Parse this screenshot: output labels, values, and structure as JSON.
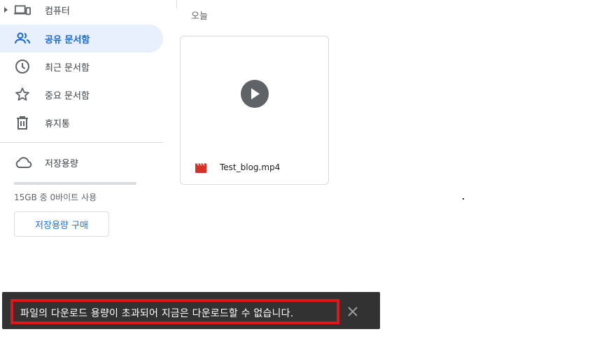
{
  "sidebar": {
    "items": [
      {
        "label": "컴퓨터",
        "icon": "computer-devices-icon",
        "active": false
      },
      {
        "label": "공유 문서함",
        "icon": "people-icon",
        "active": true
      },
      {
        "label": "최근 문서함",
        "icon": "clock-icon",
        "active": false
      },
      {
        "label": "중요 문서함",
        "icon": "star-icon",
        "active": false
      },
      {
        "label": "휴지통",
        "icon": "trash-icon",
        "active": false
      }
    ],
    "storage": {
      "label": "저장용량",
      "icon": "cloud-icon",
      "usage_text": "15GB 중 0바이트 사용",
      "used_fraction": 0,
      "buy_button_label": "저장용량 구매"
    }
  },
  "main": {
    "section_heading": "오늘",
    "files": [
      {
        "name": "Test_blog.mp4",
        "type_icon": "video-film-icon",
        "thumbnail_icon": "play-icon"
      }
    ]
  },
  "snackbar": {
    "message": "파일의 다운로드 용량이 초과되어 지금은 다운로드할 수 없습니다.",
    "close_icon": "close-icon"
  },
  "colors": {
    "accent": "#1a73e8",
    "active_bg": "#e8f0fe",
    "active_text": "#1967d2",
    "snackbar_bg": "#323232",
    "highlight_border": "#e3141b",
    "video_icon": "#d93025"
  }
}
